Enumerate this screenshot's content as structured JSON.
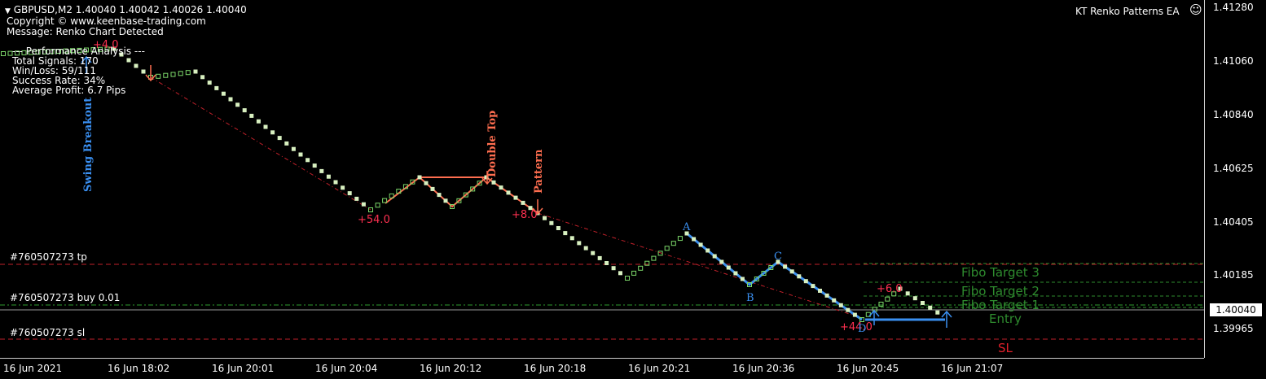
{
  "header": {
    "symbol_line": "GBPUSD,M2  1.40040 1.40042 1.40026 1.40040",
    "copyright": "Copyright © www.keenbase-trading.com",
    "message": "Message: Renko Chart Detected",
    "ea_name": "KT Renko Patterns EA",
    "smiley_icon": "smiley-face-icon"
  },
  "performance": {
    "title": "---  Performance Analysis  ---",
    "total_signals": "Total Signals: 170",
    "win_loss": "Win/Loss: 59/111",
    "success_rate": "Success Rate: 34%",
    "average_profit": "Average Profit: 6.7 Pips"
  },
  "price_scale": {
    "ticks": [
      "1.41280",
      "1.41060",
      "1.40840",
      "1.40625",
      "1.40405",
      "1.40185",
      "1.39965"
    ],
    "current_price": "1.40040"
  },
  "time_scale": {
    "ticks": [
      "16 Jun 2021",
      "16 Jun 18:02",
      "16 Jun 20:01",
      "16 Jun 20:04",
      "16 Jun 20:12",
      "16 Jun 20:18",
      "16 Jun 20:21",
      "16 Jun 20:36",
      "16 Jun 20:45",
      "16 Jun 21:07"
    ]
  },
  "order_lines": {
    "tp": "#760507273 tp",
    "buy": "#760507273 buy 0.01",
    "sl": "#760507273 sl"
  },
  "annotations": {
    "swing_breakout": "Swing Breakout",
    "double_top": "Double Top",
    "pattern": "Pattern",
    "profit_1": "+4.0",
    "profit_2": "+54.0",
    "profit_3": "+8.0",
    "profit_4": "+6.0",
    "profit_5": "+44.0",
    "point_a": "A",
    "point_b": "B",
    "point_c": "C",
    "point_d": "D"
  },
  "fibo": {
    "target_3": "Fibo Target 3",
    "target_2": "Fibo Target 2",
    "target_1": "Fibo Target 1",
    "entry": "Entry",
    "sl": "SL"
  },
  "colors": {
    "bull_brick": "#7cd86a",
    "bear_brick": "#d8f0c0",
    "red_line": "#c0202a",
    "orange_pattern": "#ff6e50",
    "blue_pattern": "#3a8ff0",
    "fibo_green": "#2e8b2e"
  }
}
